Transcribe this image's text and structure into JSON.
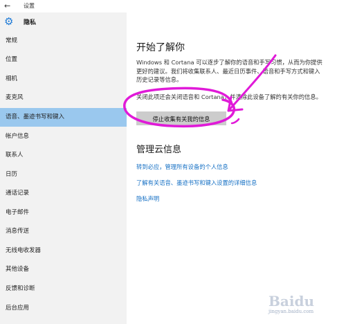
{
  "window": {
    "title": "设置"
  },
  "sidebar": {
    "header": "隐私",
    "items": [
      {
        "label": "常规"
      },
      {
        "label": "位置"
      },
      {
        "label": "相机"
      },
      {
        "label": "麦克风"
      },
      {
        "label": "语音、墨迹书写和键入"
      },
      {
        "label": "帐户信息"
      },
      {
        "label": "联系人"
      },
      {
        "label": "日历"
      },
      {
        "label": "通话记录"
      },
      {
        "label": "电子邮件"
      },
      {
        "label": "消息传送"
      },
      {
        "label": "无线电收发器"
      },
      {
        "label": "其他设备"
      },
      {
        "label": "反馈和诊断"
      },
      {
        "label": "后台应用"
      }
    ]
  },
  "main": {
    "heading": "开始了解你",
    "description": "Windows 和 Cortana 可以逐步了解你的语音和手写习惯，从而为你提供更好的建议。我们将收集联系人、最近日历事件、语音和手写方式和键入历史记录等信息。",
    "warning": "关闭此项还会关闭语音和 Cortana，并清除此设备了解的有关你的信息。",
    "stop_button": "停止收集有关我的信息",
    "cloud_heading": "管理云信息",
    "links": [
      {
        "label": "转到必应，管理所有设备的个人信息"
      },
      {
        "label": "了解有关语音、墨迹书写和键入设置的详细信息"
      },
      {
        "label": "隐私声明"
      }
    ]
  },
  "watermark": {
    "brand": "Baidu",
    "sub": "jingyan.baidu.com"
  },
  "colors": {
    "accent": "#1e7ad6",
    "selected": "#9ac8ee",
    "link": "#1670c4",
    "annotation": "#e01ad8"
  }
}
